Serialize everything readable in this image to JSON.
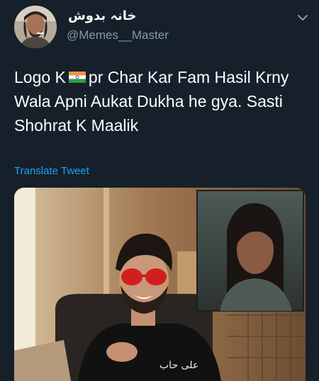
{
  "user": {
    "display_name": "خانہ بدوش",
    "handle": "@Memes__Master",
    "avatar_icon": "profile-photo"
  },
  "tweet": {
    "text_before_flag": "Logo K",
    "flag_icon": "india-flag-emoji",
    "text_after_flag": "pr Char Kar Fam Hasil Krny Wala Apni Aukat Dukha he gya. Sasti Shohrat K Maalik",
    "translate_label": "Translate Tweet"
  },
  "media": {
    "inset_overlay_text": "على حاب",
    "description_icon": "photo-collage"
  },
  "colors": {
    "background": "#15202b",
    "text": "#ffffff",
    "secondary": "#8899a6",
    "link": "#1da1f2"
  }
}
